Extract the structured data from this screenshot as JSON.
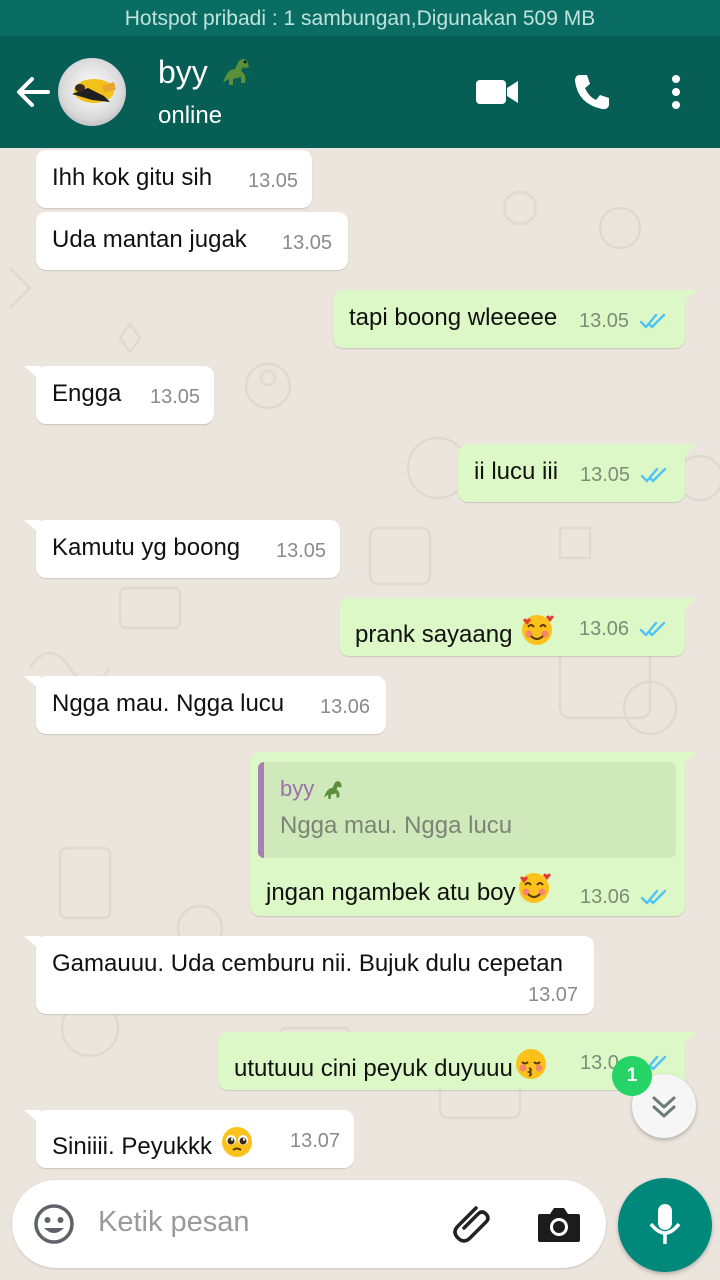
{
  "status_bar": {
    "text": "Hotspot pribadi : 1 sambungan,Digunakan 509 MB"
  },
  "header": {
    "contact_name": "byy",
    "contact_status": "online",
    "icons": [
      "back-arrow-icon",
      "video-call-icon",
      "phone-icon",
      "more-vert-icon"
    ]
  },
  "colors": {
    "app_bar": "#075e54",
    "status_bar": "#0a6d63",
    "incoming_bubble": "#ffffff",
    "outgoing_bubble": "#dcf8c6",
    "read_ticks": "#4fc3f7",
    "accent": "#00897b",
    "badge": "#25d366"
  },
  "messages": [
    {
      "direction": "in",
      "text": "Ihh kok gitu sih",
      "time": "13.05"
    },
    {
      "direction": "in",
      "text": "Uda mantan jugak",
      "time": "13.05"
    },
    {
      "direction": "out",
      "text": "tapi boong wleeeee",
      "time": "13.05",
      "status": "read"
    },
    {
      "direction": "in",
      "text": "Engga",
      "time": "13.05"
    },
    {
      "direction": "out",
      "text": "ii lucu iii",
      "time": "13.05",
      "status": "read"
    },
    {
      "direction": "in",
      "text": "Kamutu yg boong",
      "time": "13.05"
    },
    {
      "direction": "out",
      "text": "prank sayaang",
      "emoji": "smiling-face-with-hearts",
      "time": "13.06",
      "status": "read"
    },
    {
      "direction": "in",
      "text": "Ngga mau. Ngga lucu",
      "time": "13.06"
    },
    {
      "direction": "out",
      "text": "jngan ngambek atu boy",
      "emoji": "smiling-face-with-hearts",
      "time": "13.06",
      "status": "read",
      "quoted": {
        "name": "byy",
        "text": "Ngga mau. Ngga lucu"
      }
    },
    {
      "direction": "in",
      "text": "Gamauuu. Uda cemburu nii. Bujuk dulu cepetan",
      "time": "13.07"
    },
    {
      "direction": "out",
      "text": "ututuuu cini peyuk duyuuu",
      "emoji": "kissing-face-with-closed-eyes",
      "time": "13.0",
      "status": "read"
    },
    {
      "direction": "in",
      "text": "Siniiii. Peyukkk",
      "emoji": "pleading-face",
      "time": "13.07"
    }
  ],
  "scroll_to_bottom": {
    "unread_count": "1"
  },
  "composer": {
    "placeholder": "Ketik pesan"
  }
}
